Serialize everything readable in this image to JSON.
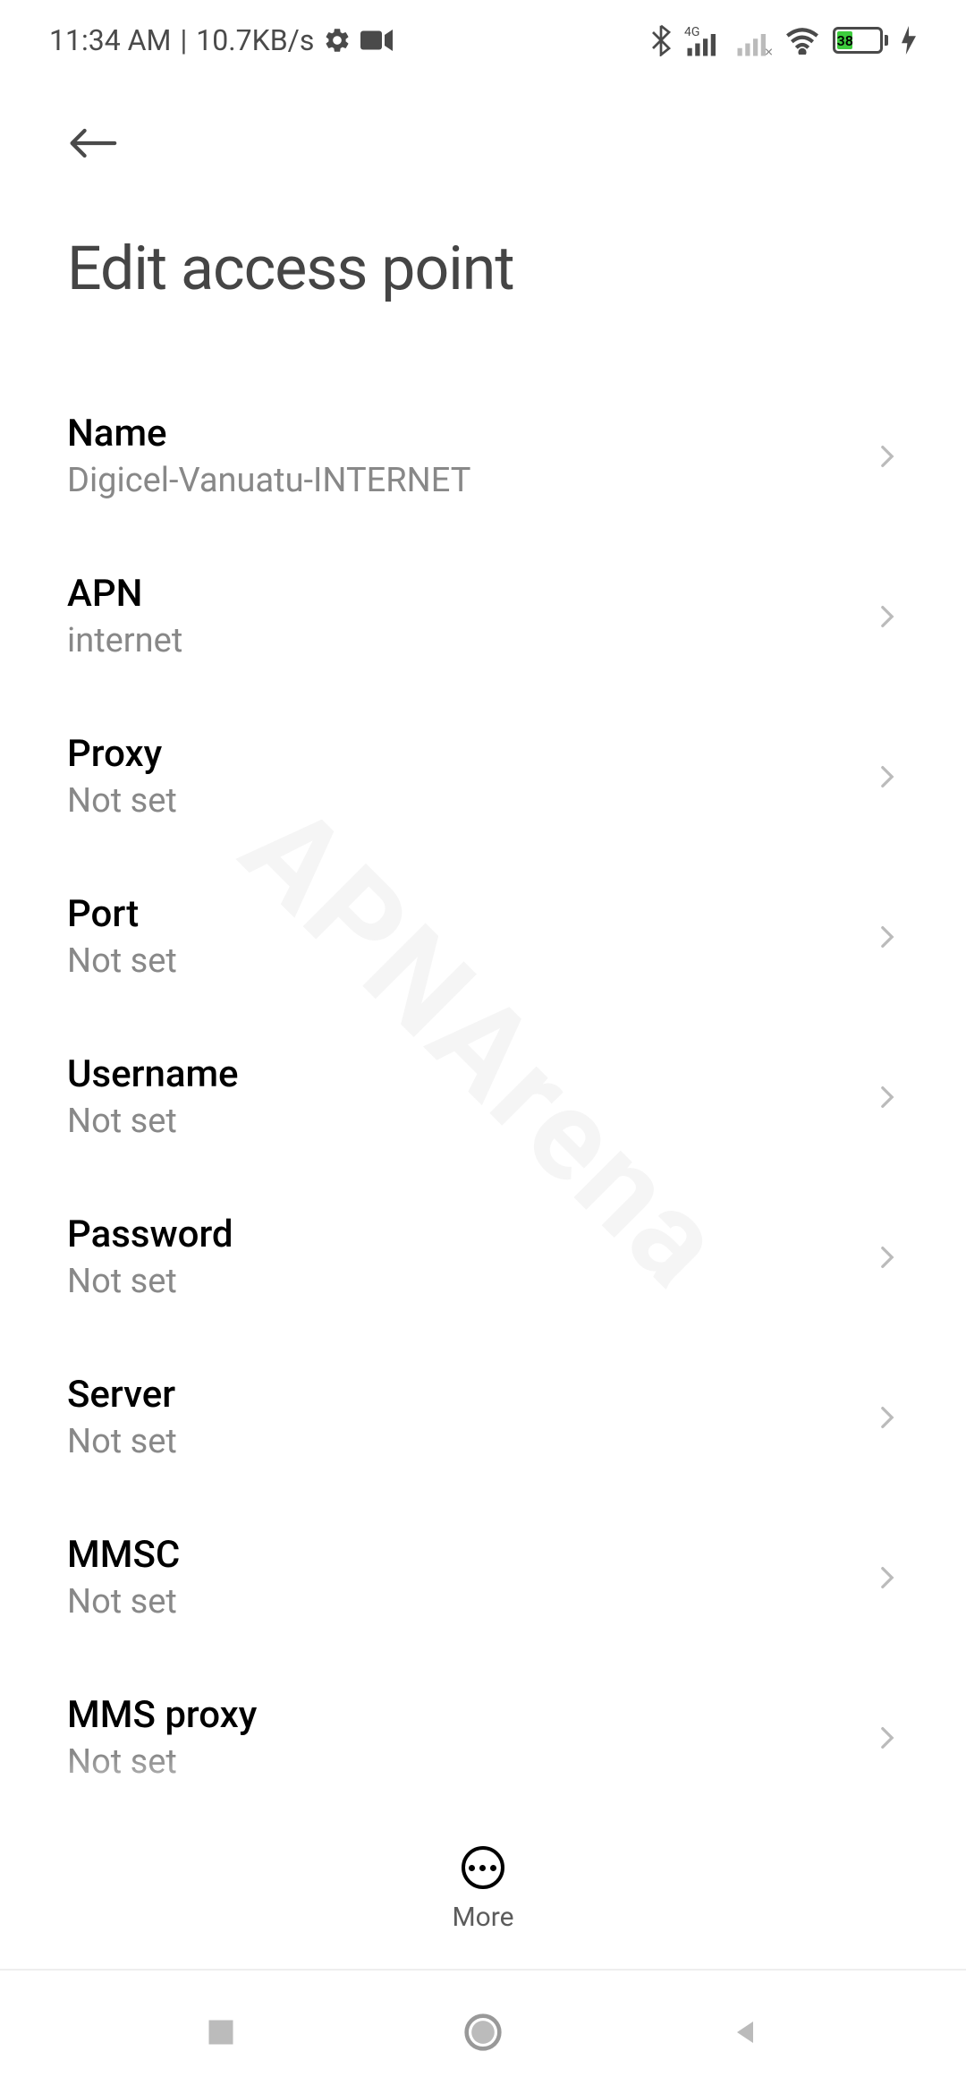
{
  "statusBar": {
    "time": "11:34 AM",
    "dataRate": "10.7KB/s",
    "battery": "38"
  },
  "header": {
    "title": "Edit access point"
  },
  "settings": [
    {
      "label": "Name",
      "value": "Digicel-Vanuatu-INTERNET"
    },
    {
      "label": "APN",
      "value": "internet"
    },
    {
      "label": "Proxy",
      "value": "Not set"
    },
    {
      "label": "Port",
      "value": "Not set"
    },
    {
      "label": "Username",
      "value": "Not set"
    },
    {
      "label": "Password",
      "value": "Not set"
    },
    {
      "label": "Server",
      "value": "Not set"
    },
    {
      "label": "MMSC",
      "value": "Not set"
    },
    {
      "label": "MMS proxy",
      "value": "Not set"
    }
  ],
  "bottomBar": {
    "moreLabel": "More"
  },
  "watermark": "APNArena"
}
